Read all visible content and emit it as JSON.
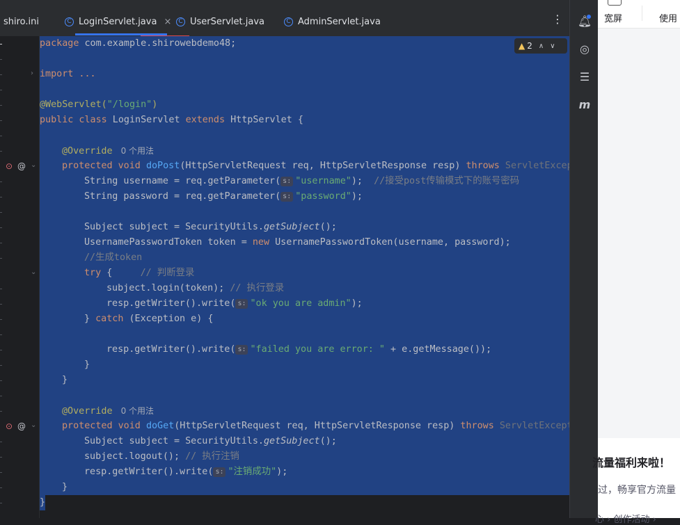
{
  "tabs": [
    {
      "label": "shiro.ini",
      "active": false
    },
    {
      "label": "LoginServlet.java",
      "active": true
    },
    {
      "label": "UserServlet.java",
      "active": false
    },
    {
      "label": "AdminServlet.java",
      "active": false
    }
  ],
  "tab_close": "×",
  "more_icon": "⋮",
  "inspection": {
    "count": "2",
    "icon": "warning-icon"
  },
  "usage_hint": "0 个用法",
  "param_hint": "s:",
  "code": {
    "package_kw": "package",
    "package_name": " com.example.shirowebdemo48;",
    "import_kw": "import",
    "import_rest": " ...",
    "webservlet_ann": "@WebServlet(",
    "webservlet_path": "\"/login\"",
    "webservlet_close": ")",
    "class_decl_kw1": "public class",
    "class_name": " LoginServlet ",
    "class_extends": "extends",
    "class_parent": " HttpServlet {",
    "override": "@Override",
    "protected_void": "protected void",
    "dopost_name": "doPost",
    "dopost_params": "(HttpServletRequest req, HttpServletResponse resp) ",
    "throws": "throws",
    "servlet_exc": " ServletExcept",
    "username_line": "String username = req.getParameter(",
    "username_str": "\"username\"",
    "username_end": ");  ",
    "username_comment": "//接受post传输模式下的账号密码",
    "password_line": "String password = req.getParameter(",
    "password_str": "\"password\"",
    "password_end": ");",
    "subject_line_a": "Subject subject = SecurityUtils.",
    "subject_line_b": "getSubject",
    "subject_line_c": "();",
    "token_line_a": "UsernamePasswordToken token = ",
    "token_new": "new",
    "token_line_b": " UsernamePasswordToken(username, password);",
    "gen_token_comment": "//生成token",
    "try_kw": "try",
    "try_rest": " {     ",
    "judge_comment": "// 判断登录",
    "login_line": "subject.login(token); ",
    "login_comment": "// 执行登录",
    "write_ok_a": "resp.getWriter().write(",
    "write_ok_str": "\"ok you are admin\"",
    "write_ok_end": ");",
    "catch_a": "} ",
    "catch_kw": "catch",
    "catch_b": " (Exception e) {",
    "write_fail_a": "resp.getWriter().write(",
    "write_fail_str": "\"failed you are error: \"",
    "write_fail_end": " + e.getMessage());",
    "close_brace": "}",
    "doget_name": "doGet",
    "doget_params": "(HttpServletRequest req, HttpServletResponse resp) ",
    "logout_line": "subject.logout(); ",
    "logout_comment": "// 执行注销",
    "write_logout_a": "resp.getWriter().write(",
    "write_logout_str": "\"注销成功\"",
    "write_logout_end": ");"
  },
  "web": {
    "wide_label": "宽屏",
    "use_label": "使用",
    "promo_title": "流量福利来啦！",
    "promo_text": "过，畅享官方流量",
    "promo_bottom": "心 › 创作活动 ›"
  }
}
